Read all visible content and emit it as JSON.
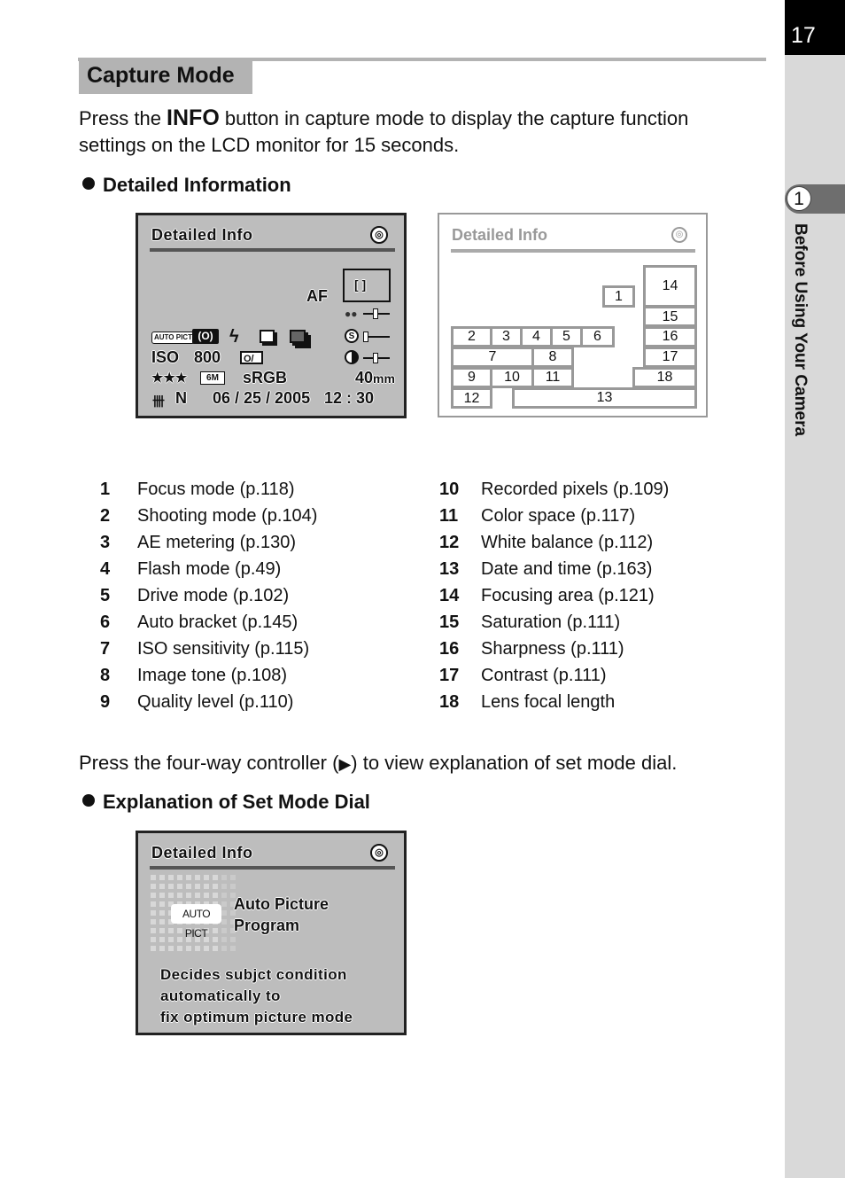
{
  "side": {
    "page_number": "17",
    "chapter_number": "1",
    "chapter_title": "Before Using Your Camera"
  },
  "section": {
    "title": "Capture Mode",
    "intro_prefix": "Press the ",
    "intro_bold": "INFO",
    "intro_suffix": " button in capture mode to display the capture function",
    "intro_line2": "settings on the LCD monitor for 15 seconds."
  },
  "detailed": {
    "heading": "Detailed Information",
    "lcd": {
      "title": "Detailed Info",
      "af_label": "AF",
      "focus_area": "[ ]",
      "shooting_mode": "AUTO PICT",
      "iso_label": "ISO",
      "iso_value": "800",
      "quality": "★★★",
      "pixels": "6M",
      "color_space": "sRGB",
      "focal_length": "40",
      "focal_unit": "mm",
      "wb": "N",
      "date": "06 / 25 / 2005",
      "time": "12 : 30",
      "icons": [
        "info-dial-icon",
        "metering-icon",
        "flash-icon",
        "drive-icon",
        "auto-bracket-icon",
        "image-tone-icon",
        "saturation-icon",
        "sharpness-icon",
        "contrast-icon",
        "white-balance-icon"
      ]
    },
    "diagram": {
      "title": "Detailed Info",
      "cells": [
        "1",
        "2",
        "3",
        "4",
        "5",
        "6",
        "7",
        "8",
        "9",
        "10",
        "11",
        "12",
        "13",
        "14",
        "15",
        "16",
        "17",
        "18"
      ]
    }
  },
  "legend": {
    "left": [
      {
        "num": "1",
        "text": "Focus mode (p.118)"
      },
      {
        "num": "2",
        "text": "Shooting mode (p.104)"
      },
      {
        "num": "3",
        "text": "AE metering (p.130)"
      },
      {
        "num": "4",
        "text": "Flash mode (p.49)"
      },
      {
        "num": "5",
        "text": "Drive mode (p.102)"
      },
      {
        "num": "6",
        "text": "Auto bracket (p.145)"
      },
      {
        "num": "7",
        "text": "ISO sensitivity (p.115)"
      },
      {
        "num": "8",
        "text": "Image tone (p.108)"
      },
      {
        "num": "9",
        "text": "Quality level (p.110)"
      }
    ],
    "right": [
      {
        "num": "10",
        "text": "Recorded pixels (p.109)"
      },
      {
        "num": "11",
        "text": "Color space (p.117)"
      },
      {
        "num": "12",
        "text": "White balance (p.112)"
      },
      {
        "num": "13",
        "text": "Date and time (p.163)"
      },
      {
        "num": "14",
        "text": "Focusing area (p.121)"
      },
      {
        "num": "15",
        "text": "Saturation (p.111)"
      },
      {
        "num": "16",
        "text": "Sharpness (p.111)"
      },
      {
        "num": "17",
        "text": "Contrast (p.111)"
      },
      {
        "num": "18",
        "text": "Lens focal length"
      }
    ]
  },
  "controller": {
    "text_prefix": "Press the four-way controller (",
    "arrow": "▶",
    "text_suffix": ") to view explanation of set mode dial."
  },
  "mode_dial": {
    "heading": "Explanation of Set Mode Dial",
    "lcd": {
      "title": "Detailed Info",
      "badge": "AUTO PICT",
      "mode_line1": "Auto Picture",
      "mode_line2": "Program",
      "desc_line1": "Decides subjct condition",
      "desc_line2": "automatically to",
      "desc_line3": "fix optimum picture mode"
    }
  }
}
